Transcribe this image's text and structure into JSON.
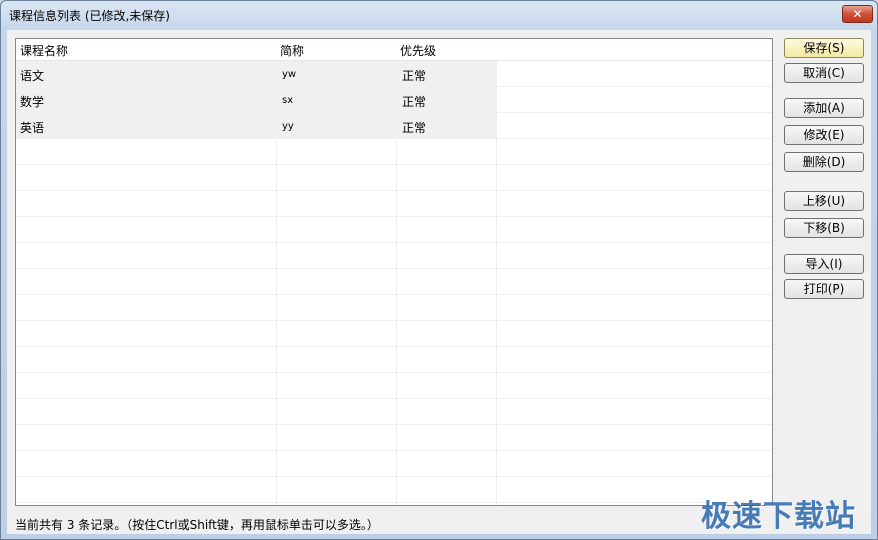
{
  "window": {
    "title": "课程信息列表 (已修改,未保存)",
    "close_glyph": "✕"
  },
  "grid": {
    "columns": [
      "课程名称",
      "简称",
      "优先级"
    ],
    "rows": [
      {
        "name": "语文",
        "abbr": "yw",
        "priority": "正常"
      },
      {
        "name": "数学",
        "abbr": "sx",
        "priority": "正常"
      },
      {
        "name": "英语",
        "abbr": "yy",
        "priority": "正常"
      }
    ]
  },
  "buttons": {
    "save": "保存(S)",
    "cancel": "取消(C)",
    "add": "添加(A)",
    "edit": "修改(E)",
    "delete": "删除(D)",
    "move_up": "上移(U)",
    "move_down": "下移(B)",
    "import": "导入(I)",
    "print": "打印(P)"
  },
  "status_text": "当前共有 3 条记录。（按住Ctrl或Shift键，再用鼠标单击可以多选。）",
  "watermark_text": "极速下载站"
}
